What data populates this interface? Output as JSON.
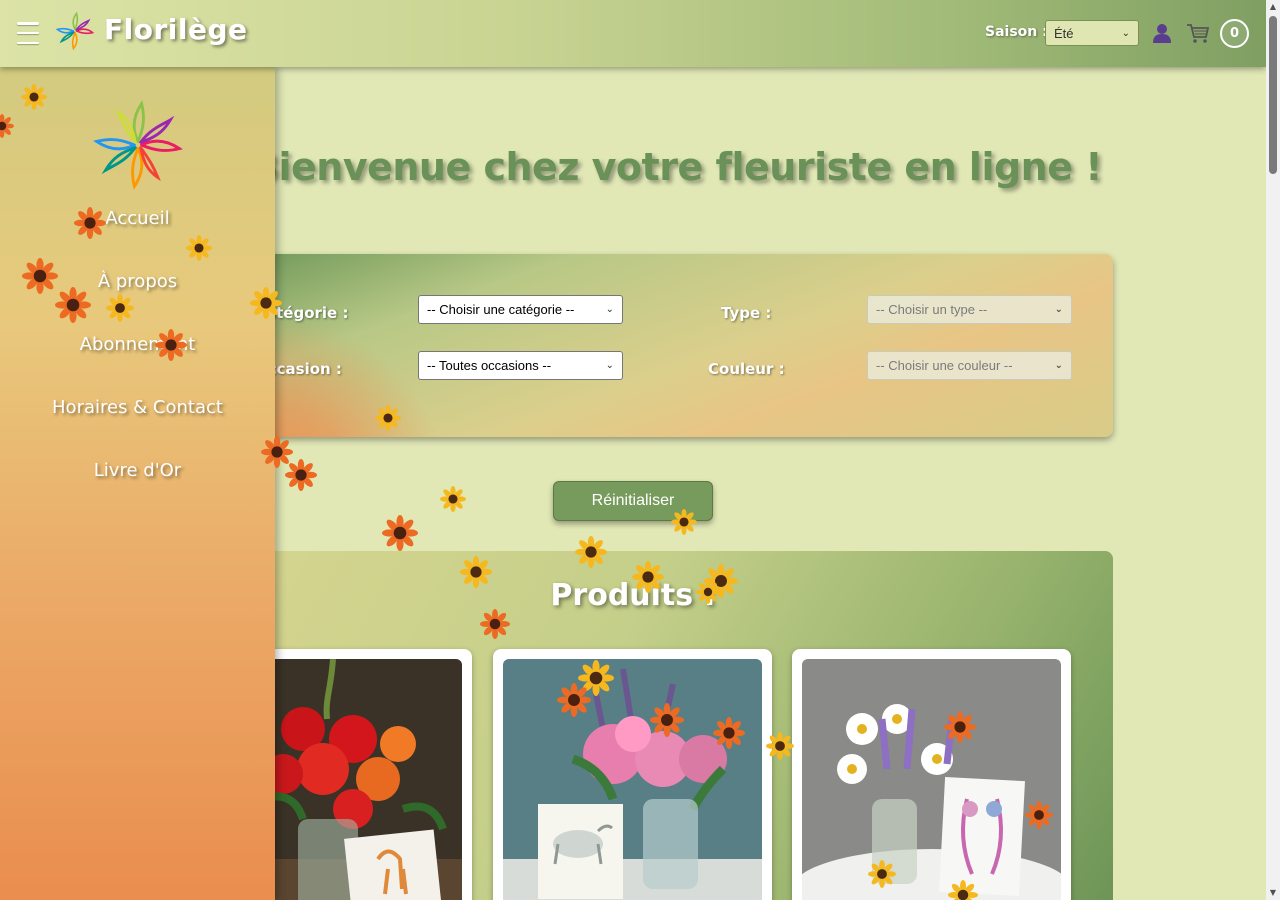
{
  "header": {
    "brand": "Florilège",
    "season_label": "Saison :",
    "season_selected": "Été",
    "cart_count": "0"
  },
  "sidebar": {
    "items": [
      {
        "label": "Accueil"
      },
      {
        "label": "À propos"
      },
      {
        "label": "Abonnement"
      },
      {
        "label": "Horaires & Contact"
      },
      {
        "label": "Livre d'Or"
      }
    ]
  },
  "main": {
    "welcome": "Bienvenue chez votre fleuriste en ligne !",
    "filters": {
      "category_label": "Catégorie :",
      "category_placeholder": "-- Choisir une catégorie --",
      "type_label": "Type :",
      "type_placeholder": "-- Choisir un type --",
      "occasion_label": "Occasion :",
      "occasion_placeholder": "-- Toutes occasions --",
      "color_label": "Couleur :",
      "color_placeholder": "-- Choisir une couleur --"
    },
    "reset_label": "Réinitialiser",
    "products_title": "Produits :"
  }
}
